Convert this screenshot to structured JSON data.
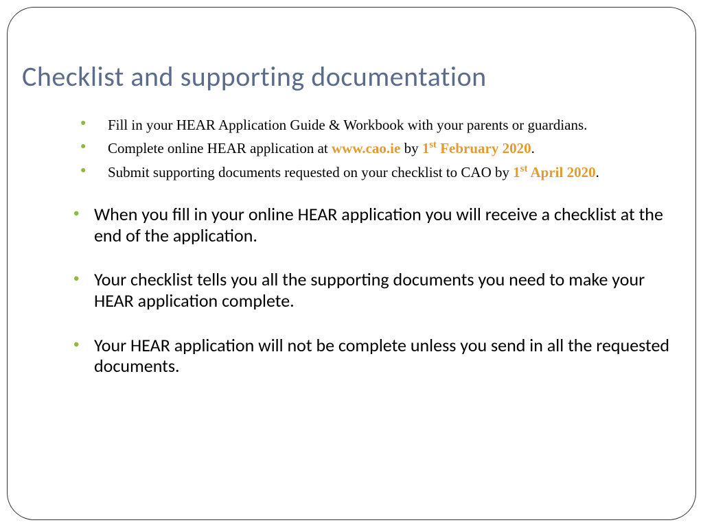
{
  "title": "Checklist and supporting documentation",
  "bullets_small": [
    {
      "text": "Fill in your HEAR Application Guide & Workbook with your parents or guardians."
    },
    {
      "prefix": "Complete online HEAR application at ",
      "link": "www.cao.ie",
      "mid": " by ",
      "date_num": "1",
      "date_sup": "st",
      "date_rest": "  February 2020",
      "suffix": "."
    },
    {
      "prefix": "Submit supporting documents  requested on your checklist to CAO by ",
      "date_num": "1",
      "date_sup": "st",
      "date_rest": " April 2020",
      "suffix": "."
    }
  ],
  "bullets_large": [
    "When you fill in your online HEAR application you will receive a checklist at the end of the application.",
    "Your checklist tells you all the supporting documents you need to make your HEAR application complete.",
    "Your HEAR application will not be complete unless you send in all the requested documents."
  ]
}
